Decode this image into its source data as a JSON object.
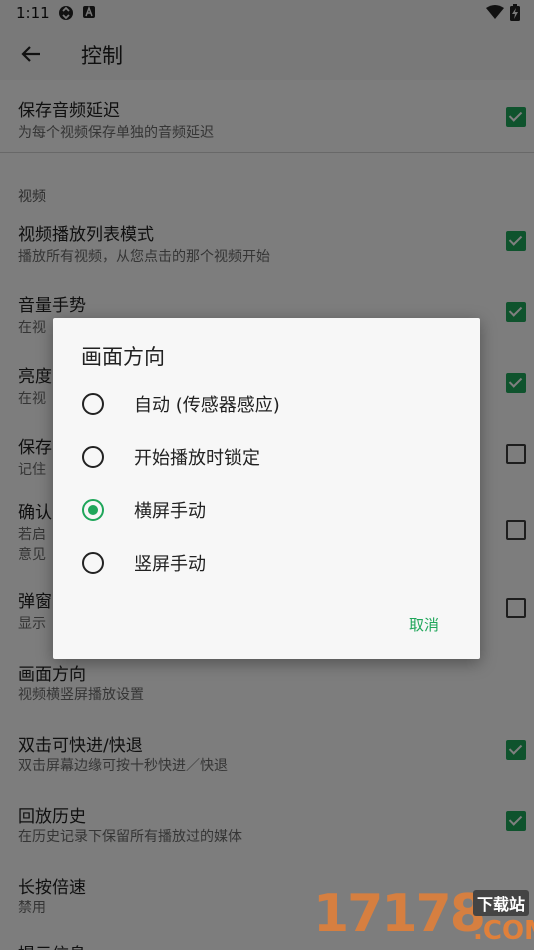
{
  "status_bar": {
    "time": "1:11"
  },
  "app_bar": {
    "title": "控制"
  },
  "settings": {
    "items": [
      {
        "title": "保存音频延迟",
        "subtitle": "为每个视频保存单独的音频延迟",
        "checked": true
      },
      {
        "title": "视频播放列表模式",
        "subtitle": "播放所有视频，从您点击的那个视频开始",
        "checked": true
      },
      {
        "title": "音量手势",
        "subtitle": "在视",
        "checked": true
      },
      {
        "title": "亮度",
        "subtitle": "在视",
        "checked": true
      },
      {
        "title": "保存",
        "subtitle": "记住",
        "checked": false
      },
      {
        "title": "确认",
        "subtitle": "若启",
        "subtitle2": "意见",
        "checked": false
      },
      {
        "title": "弹窗",
        "subtitle": "显示",
        "checked": false
      },
      {
        "title": "画面方向",
        "subtitle": "视频横竖屏播放设置"
      },
      {
        "title": "双击可快进/快退",
        "subtitle": "双击屏幕边缘可按十秒快进／快退",
        "checked": true
      },
      {
        "title": "回放历史",
        "subtitle": "在历史记录下保留所有播放过的媒体",
        "checked": true
      },
      {
        "title": "长按倍速",
        "subtitle": "禁用"
      },
      {
        "title": "提示信息",
        "subtitle": ""
      }
    ],
    "section_video": "视频"
  },
  "dialog": {
    "title": "画面方向",
    "options": [
      {
        "label": "自动 (传感器感应)",
        "selected": false
      },
      {
        "label": "开始播放时锁定",
        "selected": false
      },
      {
        "label": "横屏手动",
        "selected": true
      },
      {
        "label": "竖屏手动",
        "selected": false
      }
    ],
    "cancel_label": "取消"
  },
  "watermark": {
    "number": "17178",
    "tag": "下载站",
    "domain": ".COM"
  },
  "colors": {
    "accent": "#1fa65a",
    "scrim": "rgba(0,0,0,0.5)"
  }
}
